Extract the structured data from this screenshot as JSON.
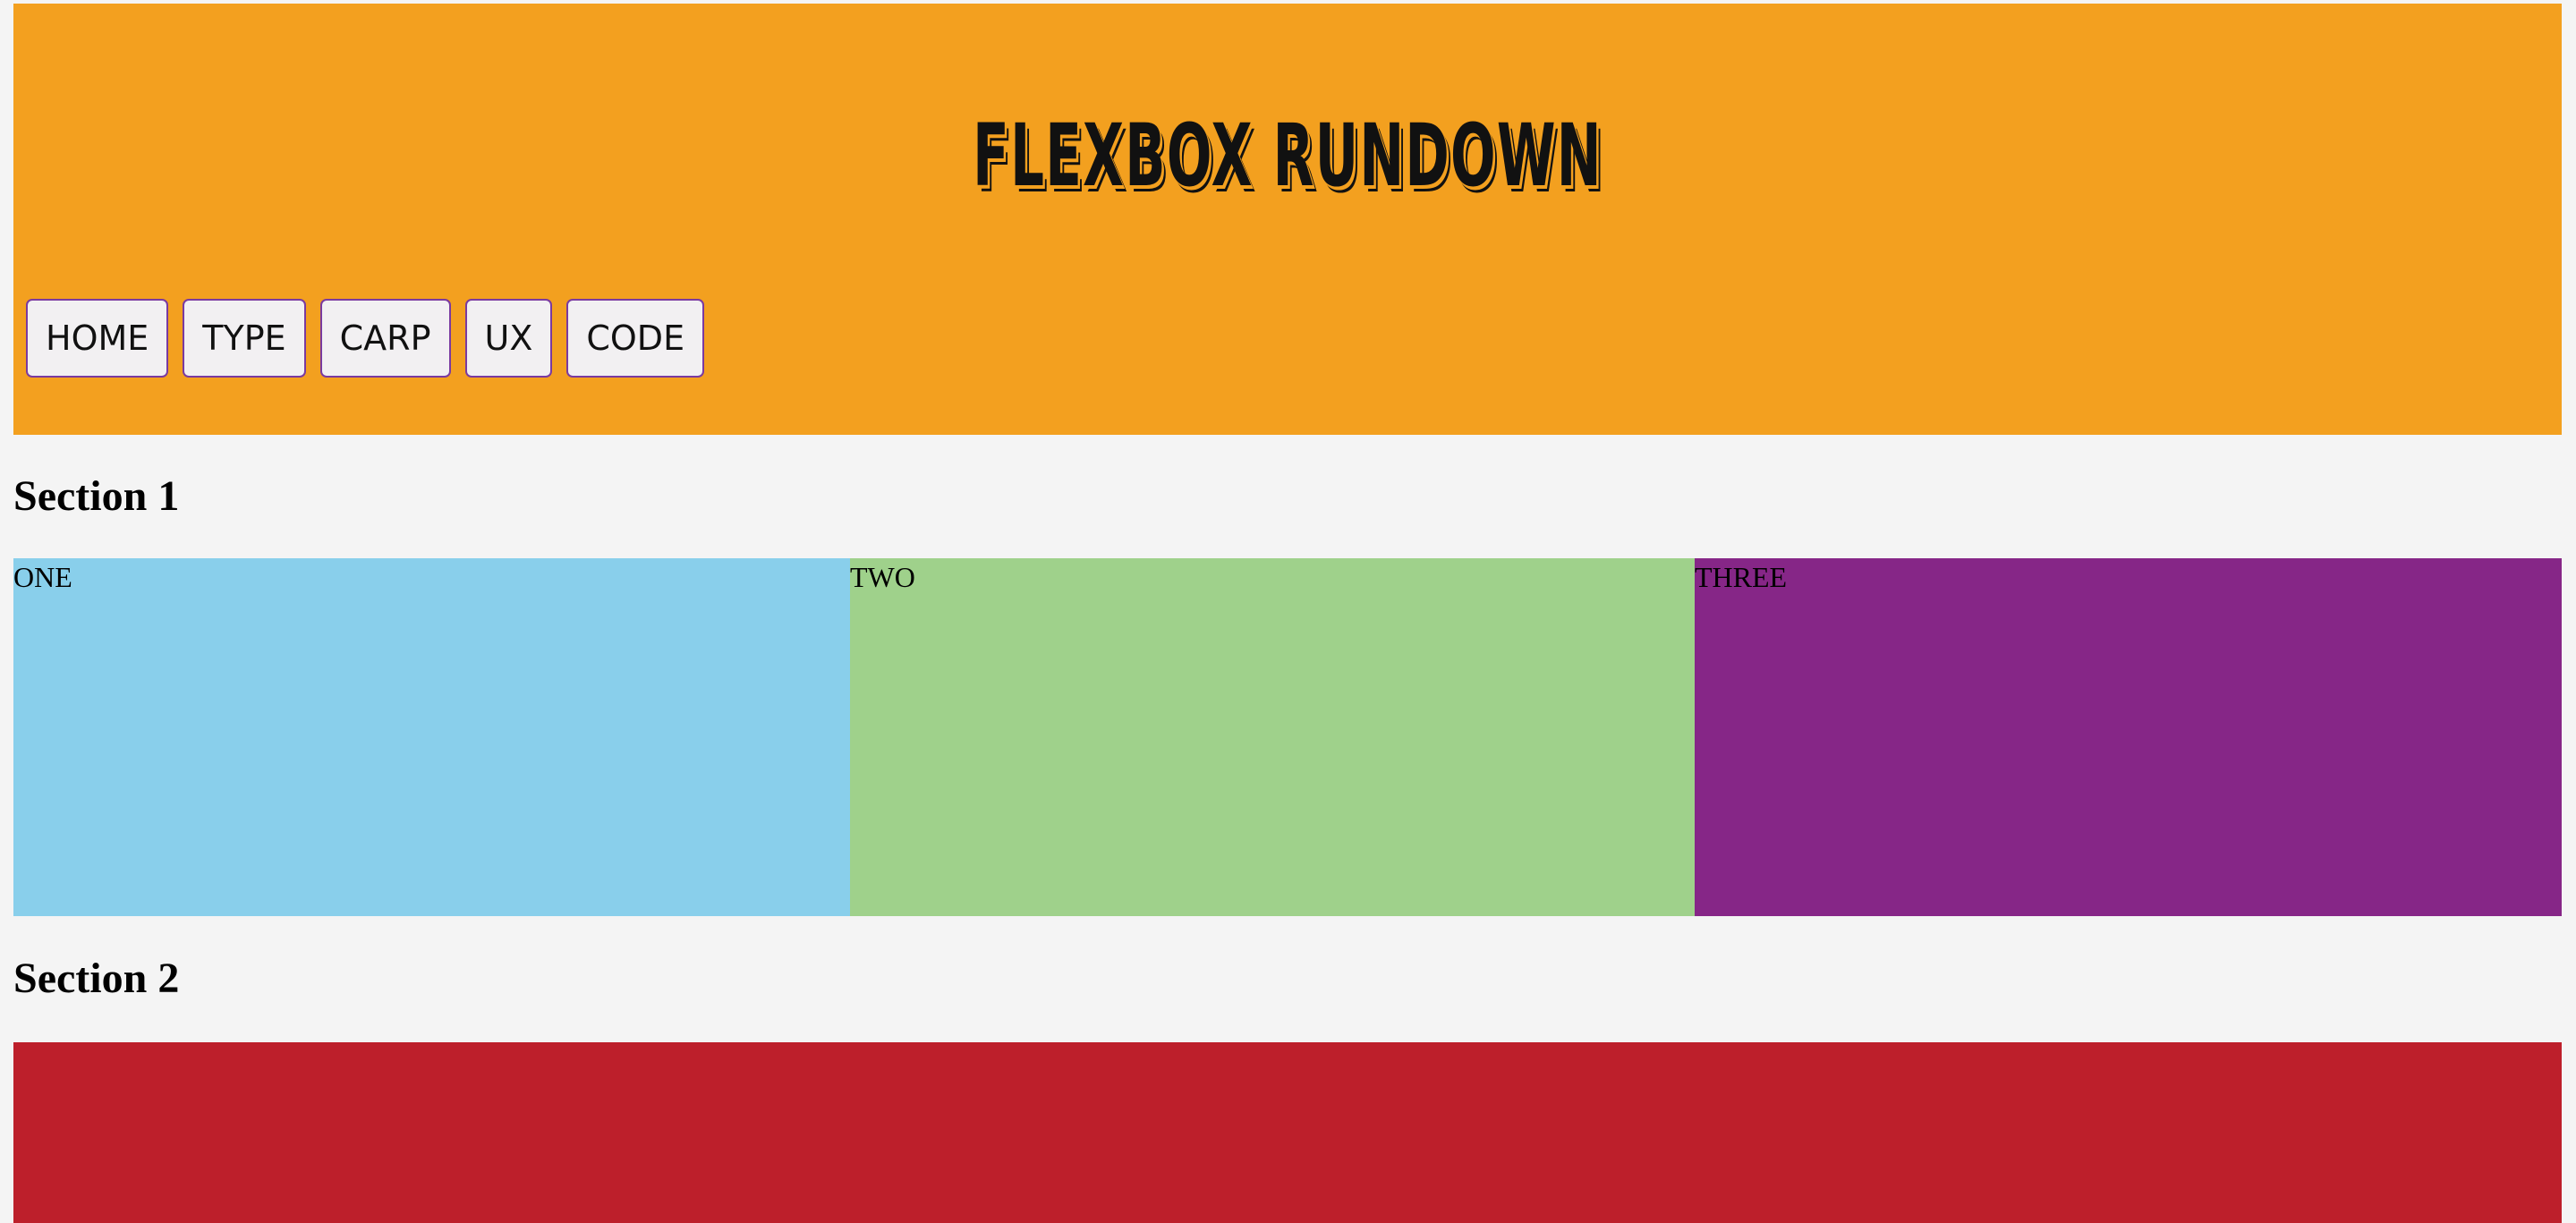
{
  "header": {
    "title": "FLEXBOX RUNDOWN",
    "background_color": "#f3a01f"
  },
  "nav": {
    "items": [
      {
        "label": "HOME"
      },
      {
        "label": "TYPE"
      },
      {
        "label": "CARP"
      },
      {
        "label": "UX"
      },
      {
        "label": "CODE"
      }
    ],
    "border_color": "#7a3aa0"
  },
  "section1": {
    "title": "Section 1",
    "boxes": [
      {
        "label": "ONE",
        "color": "#89cfeb"
      },
      {
        "label": "TWO",
        "color": "#9fd18b"
      },
      {
        "label": "THREE",
        "color": "#862687"
      }
    ]
  },
  "section2": {
    "title": "Section 2",
    "block_color": "#bd1f2b"
  }
}
